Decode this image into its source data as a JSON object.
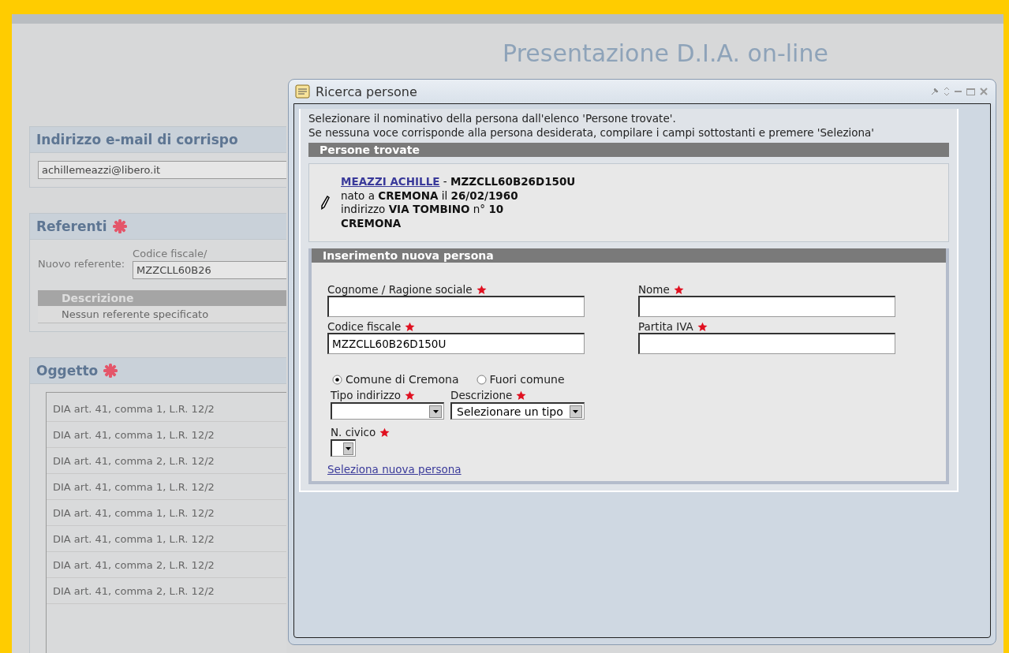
{
  "page_title": "Presentazione D.I.A. on-line",
  "email_section": {
    "title": "Indirizzo e-mail di corrispo",
    "value": "achillemeazzi@libero.it"
  },
  "referenti_section": {
    "title": "Referenti",
    "new_label": "Nuovo referente:",
    "field_label": "Codice fiscale/",
    "field_value": "MZZCLL60B26",
    "table_header": "Descrizione",
    "empty_text": "Nessun referente specificato"
  },
  "oggetto_section": {
    "title": "Oggetto",
    "items": [
      "DIA art. 41, comma 1, L.R. 12/2",
      "DIA art. 41, comma 1, L.R. 12/2",
      "DIA art. 41, comma 2, L.R. 12/2",
      "DIA art. 41, comma 1, L.R. 12/2",
      "DIA art. 41, comma 1, L.R. 12/2",
      "DIA art. 41, comma 1, L.R. 12/2",
      "DIA art. 41, comma 2, L.R. 12/2",
      "DIA art. 41, comma 2, L.R. 12/2"
    ]
  },
  "dialog": {
    "title": "Ricerca persone",
    "intro": [
      "Selezionare il nominativo della persona dall'elenco 'Persone trovate'.",
      "Se nessuna voce corrisponde alla persona desiderata, compilare i campi sottostanti e premere 'Seleziona'"
    ],
    "found_header": "Persone trovate",
    "person": {
      "name": "MEAZZI ACHILLE",
      "code": " - **MZZCLL60B26D150U**",
      "lines": [
        "nato a **CREMONA** il **26/02/1960**",
        "indirizzo **VIA TOMBINO** n° **10**",
        "**CREMONA**"
      ]
    },
    "new_header": "Inserimento nuova persona",
    "fields": [
      {
        "label": "Cognome / Ragione sociale"
      },
      {
        "label": "Nome"
      },
      {
        "label": "Codice fiscale",
        "value": "MZZCLL60B26D150U"
      },
      {
        "label": "Partita IVA"
      }
    ],
    "radios": [
      {
        "label": "Comune di Cremona",
        "selected": true
      },
      {
        "label": "Fuori comune",
        "selected": false
      }
    ],
    "selects": [
      {
        "label": "Tipo indirizzo"
      },
      {
        "label": "Descrizione",
        "value": "Selezionare un tipo"
      }
    ],
    "civico": {
      "label": "N. civico"
    },
    "link": "Seleziona nuova persona"
  }
}
